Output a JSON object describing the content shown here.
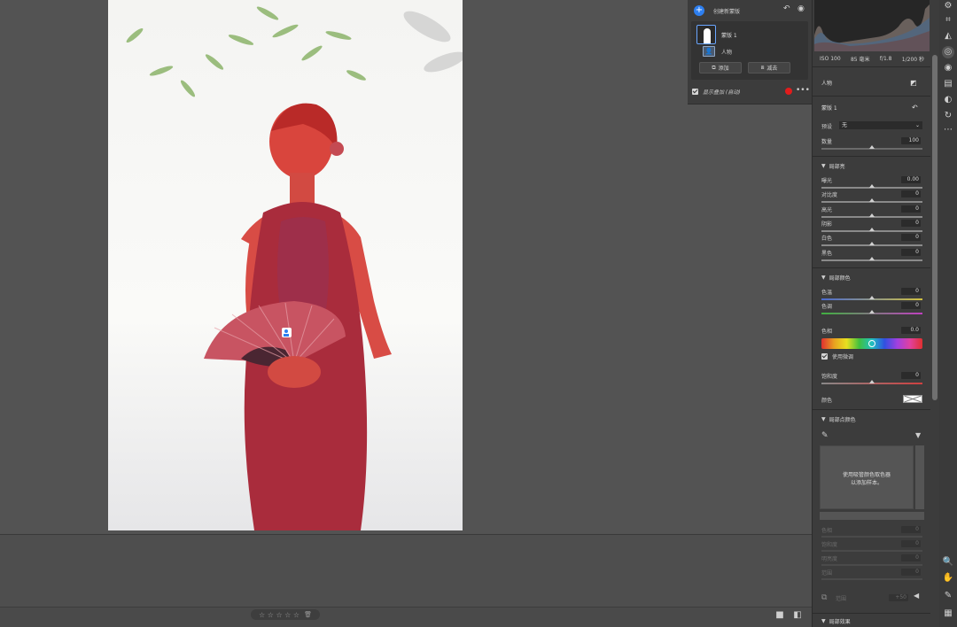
{
  "mask_panel": {
    "create_label": "创建新蒙版",
    "mask_name": "蒙版 1",
    "component_name": "人物",
    "add_label": "添加",
    "subtract_label": "减去",
    "show_overlay_label": "显示叠加 (自动)",
    "overlay_color": "#e21c1c"
  },
  "histogram": {
    "iso": "ISO 100",
    "focal": "85 毫米",
    "aperture": "f/1.8",
    "shutter": "1/200 秒"
  },
  "edit_panel": {
    "section_person": "人物",
    "mask_title": "蒙版 1",
    "preset_label": "预设",
    "preset_value": "无",
    "amount_label": "数量",
    "amount_value": "100",
    "light_title": "局部亮",
    "light_rows": [
      {
        "label": "曝光",
        "value": "0.00"
      },
      {
        "label": "对比度",
        "value": "0"
      },
      {
        "label": "高光",
        "value": "0"
      },
      {
        "label": "阴影",
        "value": "0"
      },
      {
        "label": "白色",
        "value": "0"
      },
      {
        "label": "黑色",
        "value": "0"
      }
    ],
    "color_title": "局部颜色",
    "temp_label": "色温",
    "temp_value": "0",
    "tint_label": "色调",
    "tint_value": "0",
    "hue_label": "色相",
    "hue_value": "0.0",
    "fine_label": "使用微调",
    "sat_label": "饱和度",
    "sat_value": "0",
    "color_label": "颜色",
    "point_color_title": "局部点颜色",
    "picker_hint_1": "使用吸管颜色取色器",
    "picker_hint_2": "以添加样本。",
    "point_rows": [
      {
        "label": "色相",
        "value": "0"
      },
      {
        "label": "饱和度",
        "value": "0"
      },
      {
        "label": "明亮度",
        "value": "0"
      },
      {
        "label": "范围",
        "value": "0"
      }
    ],
    "range_label": "范围",
    "range_value": "+50",
    "next_section": "局部效果"
  },
  "bottom": {
    "stars": "☆ ☆ ☆ ☆ ☆",
    "trash_icon": "🗑"
  },
  "icons": {
    "eye": "◉",
    "undo": "↶",
    "more": "•••"
  }
}
